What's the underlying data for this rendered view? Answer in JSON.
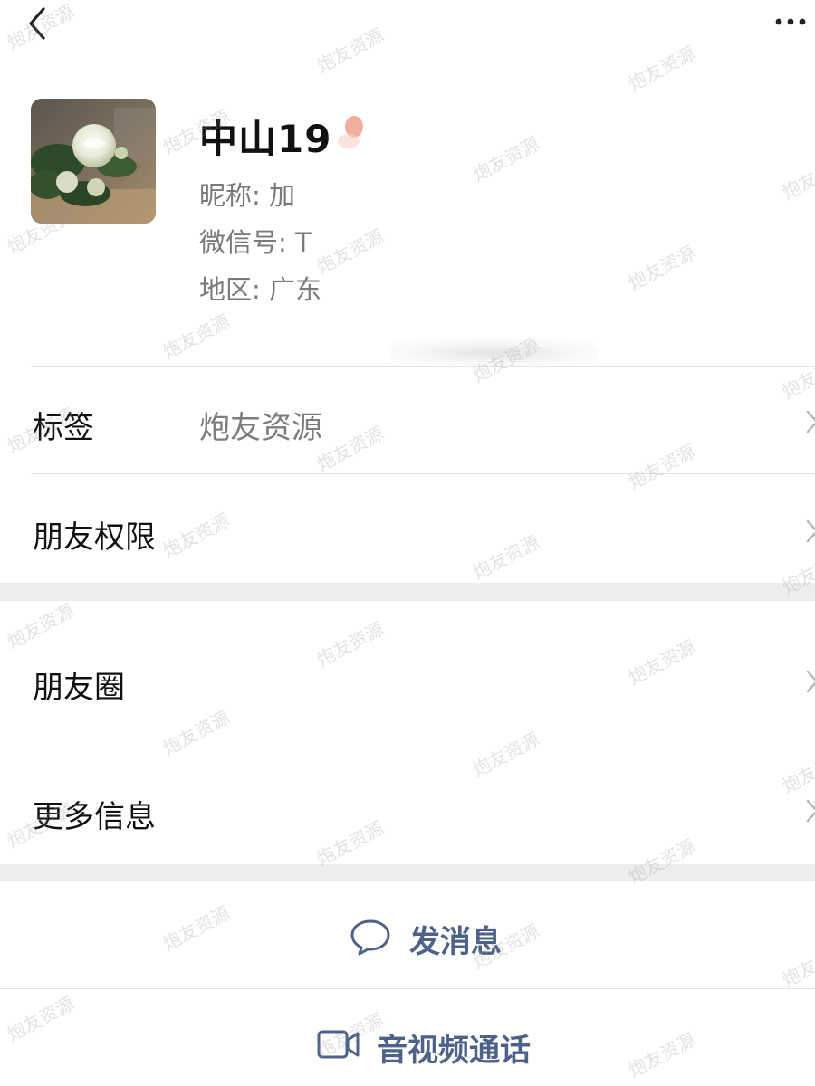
{
  "header": {
    "back_icon": "chevron-left-icon",
    "more_icon": "ellipsis-icon"
  },
  "profile": {
    "name": "中山19",
    "nickname_label": "昵称:",
    "nickname_value": "加",
    "wechat_id_label": "微信号:",
    "wechat_id_value": "T",
    "region_label": "地区:",
    "region_value": "广东"
  },
  "rows": {
    "tags": {
      "label": "标签",
      "value": "炮友资源"
    },
    "friend_permissions": {
      "label": "朋友权限"
    },
    "moments": {
      "label": "朋友圈"
    },
    "more_info": {
      "label": "更多信息"
    }
  },
  "actions": {
    "message": {
      "label": "发消息",
      "icon": "chat-bubble-icon"
    },
    "call": {
      "label": "音视频通话",
      "icon": "video-camera-icon"
    }
  },
  "watermark": {
    "text": "炮友资源"
  },
  "colors": {
    "accent": "#4d6189",
    "separator": "#ededed"
  }
}
